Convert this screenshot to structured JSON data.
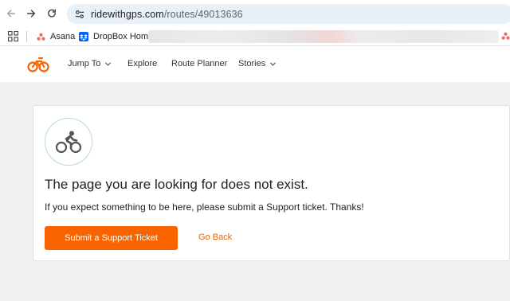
{
  "browser": {
    "url_host": "ridewithgps.com",
    "url_path": "/routes/49013636",
    "icons": [
      "back-arrow-icon",
      "forward-arrow-icon",
      "reload-icon",
      "site-settings-icon"
    ]
  },
  "bookmarks": {
    "items": [
      {
        "label": "Asana",
        "icon": "asana-icon"
      },
      {
        "label": "DropBox Home",
        "icon": "dropbox-icon"
      }
    ]
  },
  "site_nav": {
    "items": [
      {
        "label": "Jump To",
        "dropdown": true
      },
      {
        "label": "Explore",
        "dropdown": false
      },
      {
        "label": "Route Planner",
        "dropdown": false
      },
      {
        "label": "Stories",
        "dropdown": true
      }
    ]
  },
  "error_card": {
    "title": "The page you are looking for does not exist.",
    "message": "If you expect something to be here, please submit a Support ticket. Thanks!",
    "primary_button": "Submit a Support Ticket",
    "secondary_link": "Go Back"
  },
  "colors": {
    "brand_orange": "#fa6400",
    "link_orange": "#e5650d",
    "badge_border": "#b7dcd5",
    "page_background": "#f1f1f1"
  }
}
